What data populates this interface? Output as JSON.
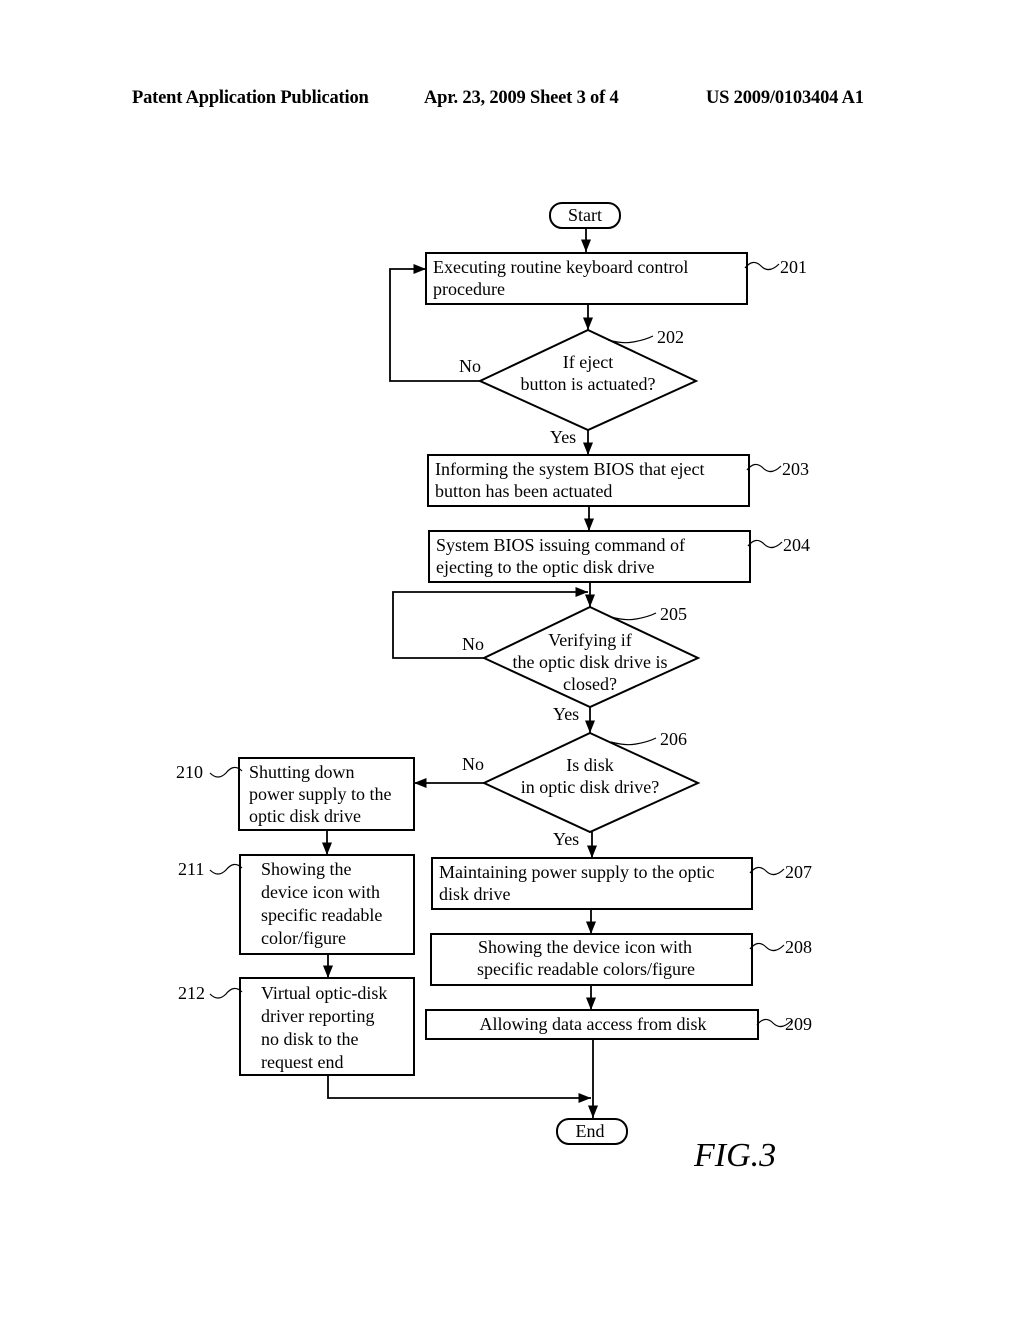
{
  "header": {
    "publication": "Patent Application Publication",
    "date_sheet": "Apr. 23, 2009  Sheet 3 of 4",
    "number": "US 2009/0103404 A1"
  },
  "figure_label": "FIG.3",
  "flowchart": {
    "start": "Start",
    "end": "End",
    "steps": {
      "s201": {
        "ref": "201",
        "lines": [
          "Executing routine keyboard control",
          "procedure"
        ]
      },
      "s202": {
        "ref": "202",
        "lines": [
          "If eject",
          "button is actuated?"
        ],
        "no": "No",
        "yes": "Yes"
      },
      "s203": {
        "ref": "203",
        "lines": [
          "Informing the system BIOS that eject",
          "button has been actuated"
        ]
      },
      "s204": {
        "ref": "204",
        "lines": [
          "System BIOS issuing command of",
          "ejecting to the optic disk drive"
        ]
      },
      "s205": {
        "ref": "205",
        "lines": [
          "Verifying if",
          "the optic disk drive is",
          "closed?"
        ],
        "no": "No",
        "yes": "Yes"
      },
      "s206": {
        "ref": "206",
        "lines": [
          "Is disk",
          "in optic disk drive?"
        ],
        "no": "No",
        "yes": "Yes"
      },
      "s207": {
        "ref": "207",
        "lines": [
          "Maintaining power supply to the optic",
          "disk drive"
        ]
      },
      "s208": {
        "ref": "208",
        "lines": [
          "Showing the device icon with",
          "specific readable colors/figure"
        ]
      },
      "s209": {
        "ref": "209",
        "lines": [
          "Allowing data access from disk"
        ]
      },
      "s210": {
        "ref": "210",
        "lines": [
          "Shutting down",
          "power supply to the",
          "optic disk drive"
        ]
      },
      "s211": {
        "ref": "211",
        "lines": [
          "Showing the",
          "device icon with",
          "specific readable",
          "color/figure"
        ]
      },
      "s212": {
        "ref": "212",
        "lines": [
          "Virtual optic-disk",
          "driver reporting",
          "no disk to the",
          "request end"
        ]
      }
    }
  }
}
